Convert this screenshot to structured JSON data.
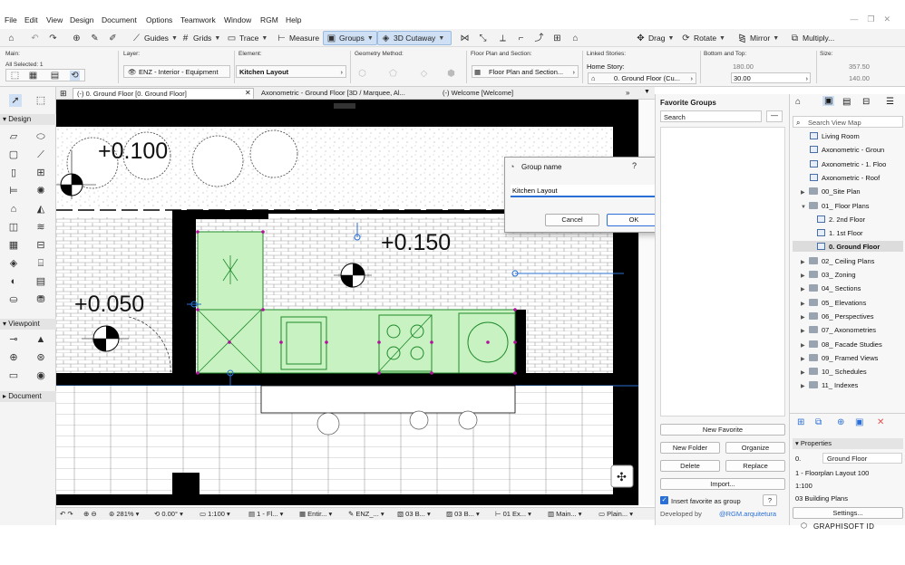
{
  "menu": [
    "File",
    "Edit",
    "View",
    "Design",
    "Document",
    "Options",
    "Teamwork",
    "Window",
    "RGM",
    "Help"
  ],
  "toolbar": {
    "guides": "Guides",
    "grids": "Grids",
    "trace": "Trace",
    "measure": "Measure",
    "groups": "Groups",
    "cutaway": "3D Cutaway",
    "drag": "Drag",
    "rotate": "Rotate",
    "mirror": "Mirror",
    "multiply": "Multiply..."
  },
  "infobox": {
    "main_label": "Main:",
    "all_selected": "All Selected: 1",
    "layer_label": "Layer:",
    "layer_value": "ENZ - Interior - Equipment",
    "element_label": "Element:",
    "element_value": "Kitchen Layout",
    "geometry_label": "Geometry Method:",
    "floorplan_label": "Floor Plan and Section:",
    "floorplan_value": "Floor Plan and Section...",
    "linked_label": "Linked Stories:",
    "home_story_label": "Home Story:",
    "home_story_value": "0. Ground Floor (Cu...",
    "bottom_top_label": "Bottom and Top:",
    "bottom_value": "180.00",
    "top_value": "30.00",
    "size_label": "Size:",
    "size_w": "357.50",
    "size_h": "140.00"
  },
  "palette": {
    "design": "Design",
    "viewpoint": "Viewpoint",
    "document": "Document"
  },
  "tabs": [
    "(-) 0. Ground Floor [0. Ground Floor]",
    "Axonometric - Ground Floor [3D / Marquee, Al...",
    "(-) Welcome [Welcome]"
  ],
  "canvas": {
    "level_1": "+0.100",
    "level_2": "+0.150",
    "level_3": "+0.050"
  },
  "status": {
    "zoom": "281%",
    "angle": "0.00°",
    "scale": "1:100",
    "layer_combo": "1 - Fl...",
    "model_view": "Entir...",
    "pen_set": "ENZ_...",
    "renovation": "03 B...",
    "graphic_override": "03 B...",
    "dimension": "01 Ex...",
    "partial": "Main...",
    "display": "Plain..."
  },
  "dialog": {
    "title": "Group name",
    "help": "?",
    "close": "✕",
    "input_value": "Kitchen Layout",
    "cancel": "Cancel",
    "ok": "OK"
  },
  "favorites": {
    "title": "Favorite Groups",
    "search_placeholder": "Search",
    "new_favorite": "New Favorite",
    "new_folder": "New Folder",
    "organize": "Organize",
    "delete": "Delete",
    "replace": "Replace",
    "import": "Import...",
    "insert_group": "Insert favorite as group",
    "developed_by": "Developed by",
    "author": "@RGM.arquitetura"
  },
  "navigator": {
    "search_placeholder": "Search View Map",
    "items": [
      {
        "label": "Living Room",
        "kind": "view"
      },
      {
        "label": "Axonometric - Groun",
        "kind": "view"
      },
      {
        "label": "Axonometric - 1. Floo",
        "kind": "view"
      },
      {
        "label": "Axonometric - Roof",
        "kind": "view"
      },
      {
        "label": "00_Site Plan",
        "kind": "folder"
      },
      {
        "label": "01_ Floor Plans",
        "kind": "folder-open"
      },
      {
        "label": "2. 2nd Floor",
        "kind": "story"
      },
      {
        "label": "1. 1st Floor",
        "kind": "story"
      },
      {
        "label": "0. Ground Floor",
        "kind": "story-selected"
      },
      {
        "label": "02_ Ceiling Plans",
        "kind": "folder"
      },
      {
        "label": "03_ Zoning",
        "kind": "folder"
      },
      {
        "label": "04_ Sections",
        "kind": "folder"
      },
      {
        "label": "05_ Elevations",
        "kind": "folder"
      },
      {
        "label": "06_ Perspectives",
        "kind": "folder"
      },
      {
        "label": "07_ Axonometries",
        "kind": "folder"
      },
      {
        "label": "08_ Facade Studies",
        "kind": "folder"
      },
      {
        "label": "09_ Framed Views",
        "kind": "folder"
      },
      {
        "label": "10_ Schedules",
        "kind": "folder"
      },
      {
        "label": "11_ Indexes",
        "kind": "folder"
      }
    ],
    "properties_header": "Properties",
    "prop_id": "0.",
    "prop_name": "Ground Floor",
    "prop_layer_combo": "1 - Floorplan Layout 100",
    "prop_scale": "1:100",
    "prop_building": "03 Building Plans",
    "settings": "Settings...",
    "brand": "GRAPHISOFT ID"
  },
  "colors": {
    "accent": "#2a6fd6",
    "kitchen_fill": "#c9f2c3",
    "kitchen_stroke": "#1e8a2a",
    "wall": "#000000",
    "hotspot": "#b0109a"
  }
}
